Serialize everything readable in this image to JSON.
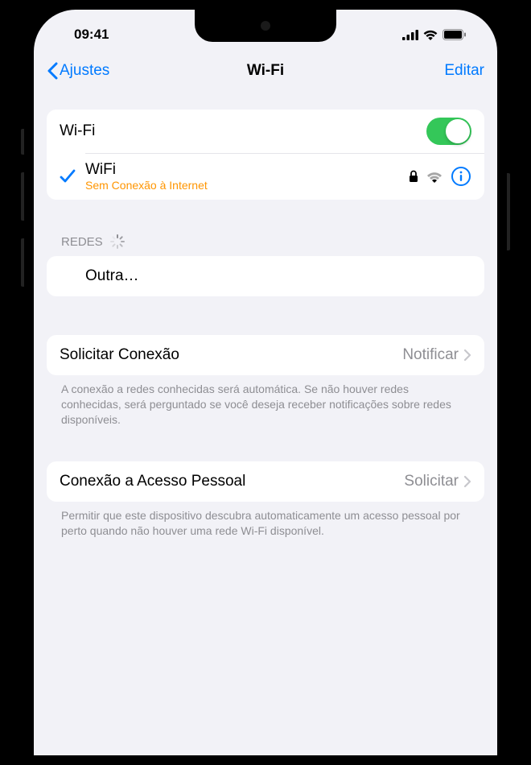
{
  "status": {
    "time": "09:41"
  },
  "nav": {
    "back": "Ajustes",
    "title": "Wi-Fi",
    "edit": "Editar"
  },
  "wifi": {
    "toggle_label": "Wi-Fi",
    "connected": {
      "name": "WiFi",
      "status": "Sem Conexão à Internet"
    }
  },
  "sections": {
    "networks_header": "REDES",
    "other": "Outra…"
  },
  "ask_to_join": {
    "label": "Solicitar Conexão",
    "value": "Notificar",
    "footer": "A conexão a redes conhecidas será automática. Se não houver redes conhecidas, será perguntado se você deseja receber notificações sobre redes disponíveis."
  },
  "hotspot": {
    "label": "Conexão a Acesso Pessoal",
    "value": "Solicitar",
    "footer": "Permitir que este dispositivo descubra automaticamente um acesso pessoal por perto quando não houver uma rede Wi-Fi disponível."
  }
}
